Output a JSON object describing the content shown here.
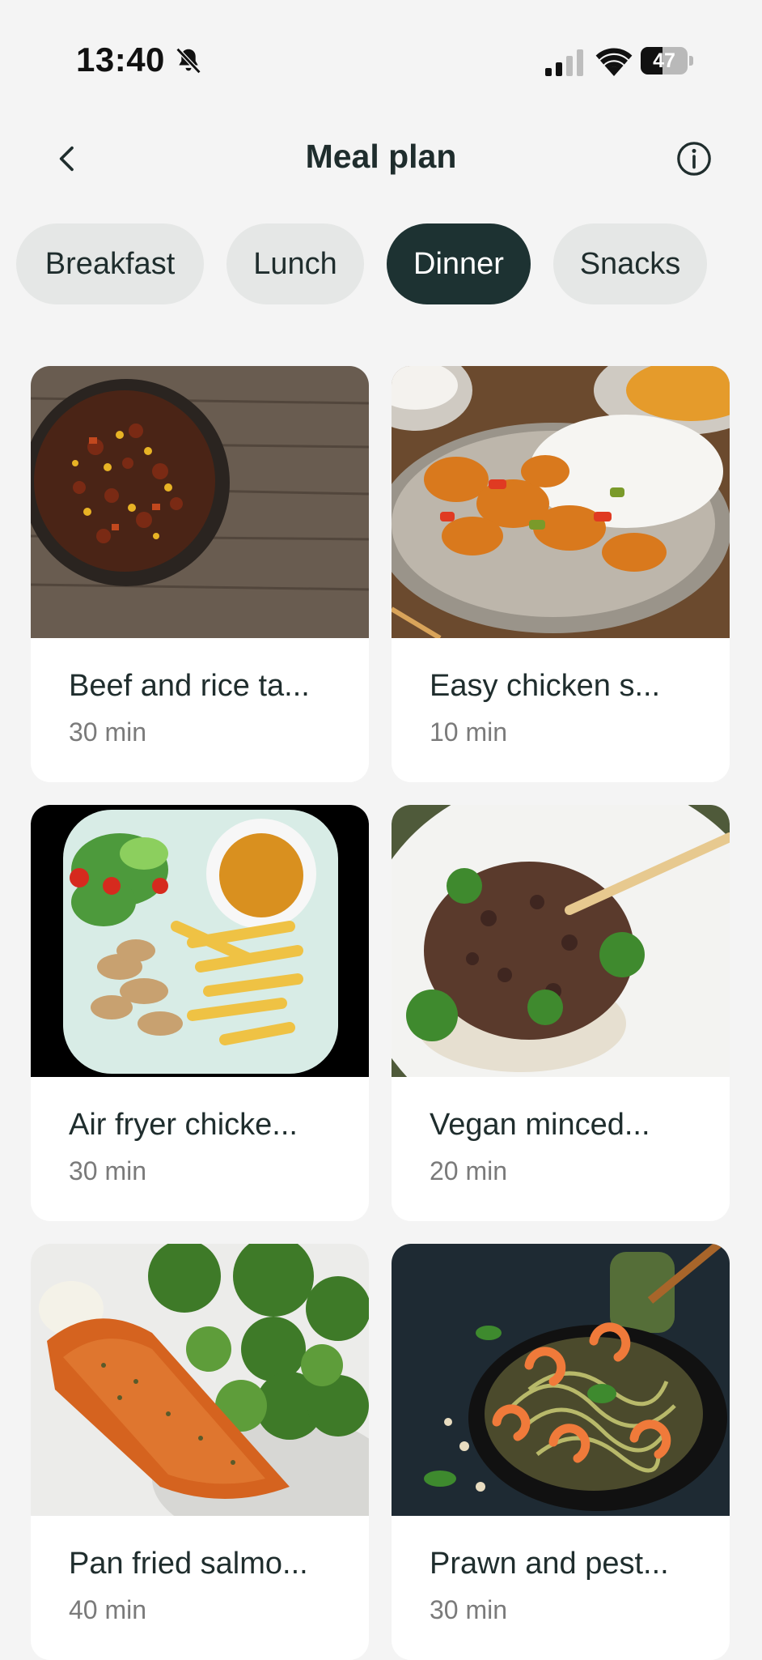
{
  "status_bar": {
    "time": "13:40",
    "battery_level": "47",
    "battery_fraction": 0.47,
    "icons": [
      "bell-muted-icon",
      "signal-icon",
      "wifi-icon",
      "battery-icon"
    ]
  },
  "header": {
    "title": "Meal plan",
    "back_icon": "chevron-left-icon",
    "info_icon": "info-icon"
  },
  "tabs": [
    {
      "label": "Breakfast",
      "active": false
    },
    {
      "label": "Lunch",
      "active": false
    },
    {
      "label": "Dinner",
      "active": true
    },
    {
      "label": "Snacks",
      "active": false
    }
  ],
  "meals": [
    {
      "title": "Beef and rice ta...",
      "time": "30 min"
    },
    {
      "title": "Easy chicken s...",
      "time": "10 min"
    },
    {
      "title": "Air fryer chicke...",
      "time": "30 min"
    },
    {
      "title": "Vegan minced...",
      "time": "20 min"
    },
    {
      "title": "Pan fried salmo...",
      "time": "40 min"
    },
    {
      "title": "Prawn and pest...",
      "time": "30 min"
    }
  ],
  "colors": {
    "background": "#f4f4f4",
    "active_tab": "#1d3232",
    "inactive_tab": "#e5e7e6",
    "text_primary": "#1f2d2d",
    "text_secondary": "#7a7a7a"
  }
}
